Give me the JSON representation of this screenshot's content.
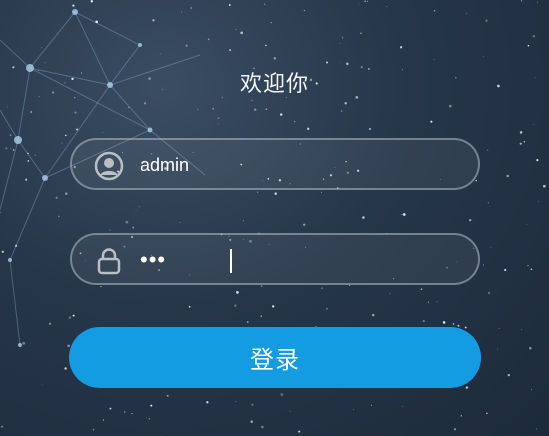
{
  "login": {
    "title": "欢迎你",
    "username": {
      "value": "admin",
      "icon": "user-icon"
    },
    "password": {
      "value": "•••",
      "icon": "lock-icon"
    },
    "submit_label": "登录"
  },
  "colors": {
    "accent": "#149ce2",
    "background": "#263649",
    "border": "#afb9c6"
  }
}
